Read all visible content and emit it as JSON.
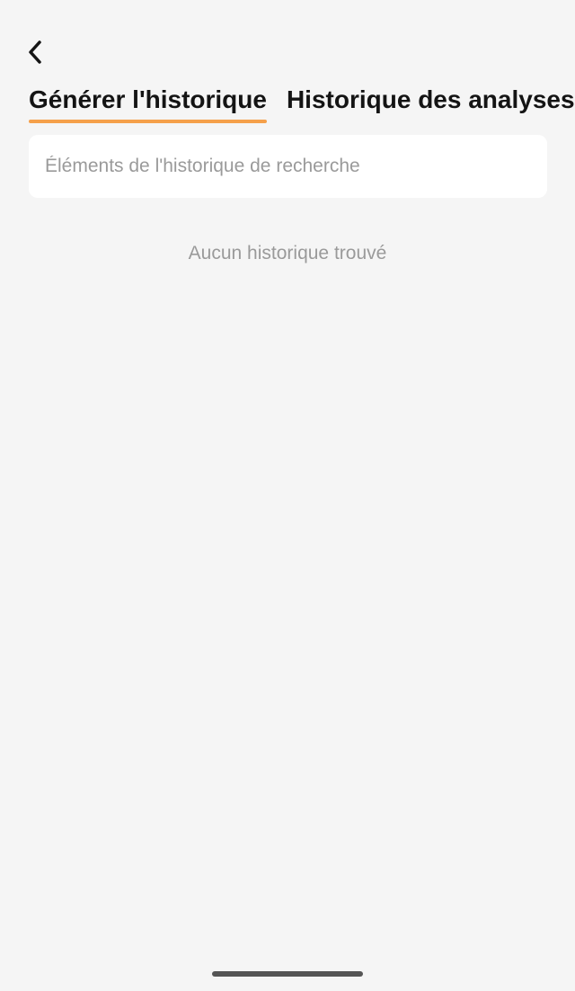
{
  "header": {
    "back_icon": "chevron-left-icon"
  },
  "tabs": [
    {
      "label": "Générer l'historique",
      "active": true
    },
    {
      "label": "Historique des analyses",
      "active": false
    }
  ],
  "search": {
    "value": "",
    "placeholder": "Éléments de l'historique de recherche"
  },
  "empty_state": {
    "message": "Aucun historique trouvé"
  },
  "colors": {
    "accent": "#f5a04a",
    "background": "#f5f5f5",
    "text_primary": "#141414",
    "text_muted": "#9a9a9a"
  }
}
